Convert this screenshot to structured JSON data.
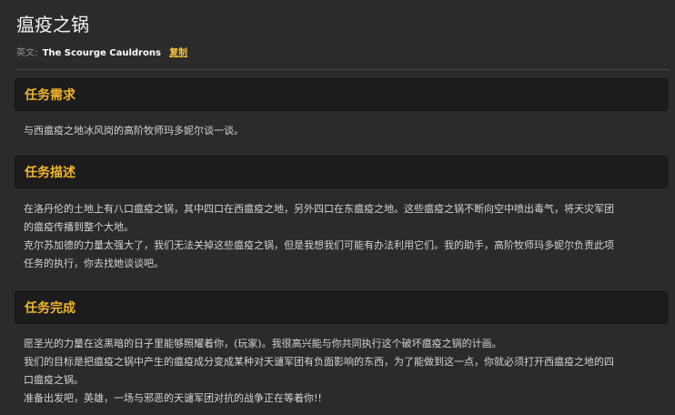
{
  "page": {
    "title": "瘟疫之锅",
    "english_label": "英文:",
    "english_name": "The Scourge Cauldrons",
    "copy_label": "复制"
  },
  "sections": [
    {
      "header": "任务需求",
      "lines": [
        "与西瘟疫之地冰风岗的高阶牧师玛多妮尔谈一谈。"
      ]
    },
    {
      "header": "任务描述",
      "lines": [
        "在洛丹伦的土地上有八口瘟疫之锅，其中四口在西瘟疫之地，另外四口在东瘟疫之地。这些瘟疫之锅不断向空中喷出毒气，将天灾军团",
        "的瘟疫传播到整个大地。",
        "克尔苏加德的力量太强大了，我们无法关掉这些瘟疫之锅，但是我想我们可能有办法利用它们。我的助手，高阶牧师玛多妮尔负责此项",
        "任务的执行，你去找她谈谈吧。"
      ]
    },
    {
      "header": "任务完成",
      "lines": [
        "愿圣光的力量在这黑暗的日子里能够照耀着你，(玩家)。我很高兴能与你共同执行这个破坏瘟疫之锅的计画。",
        "我们的目标是把瘟疫之锅中产生的瘟疫成分变成某种对天谴军团有负面影响的东西，为了能做到这一点，你就必须打开西瘟疫之地的四",
        "口瘟疫之锅。",
        "准备出发吧，英雄，一场与邪恶的天谴军团对抗的战争正在等着你!!"
      ]
    }
  ]
}
